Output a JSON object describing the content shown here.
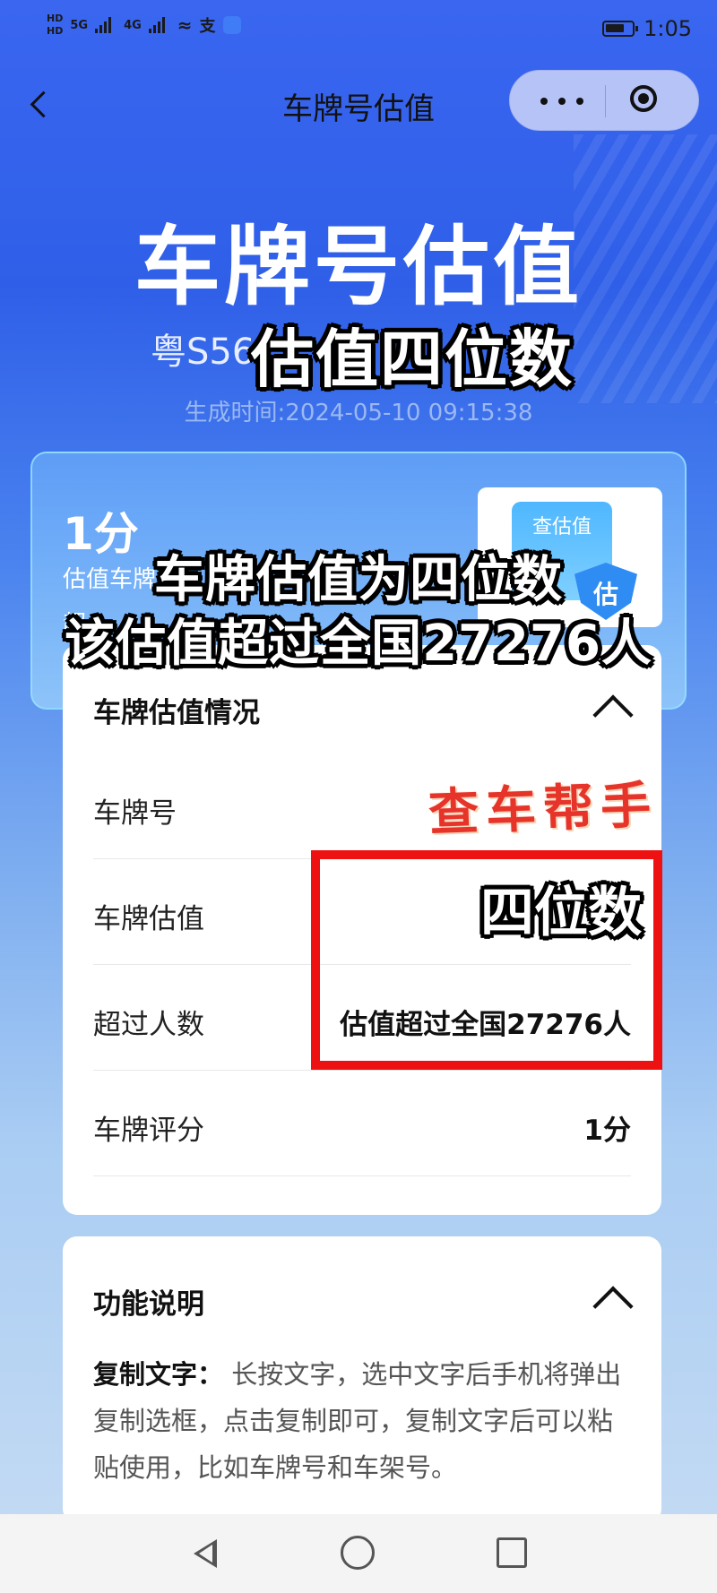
{
  "status_bar": {
    "hd1": "HD",
    "hd2": "HD",
    "net1": "5G",
    "net2": "4G",
    "time": "1:05"
  },
  "nav": {
    "title": "车牌号估值"
  },
  "hero": {
    "title": "车牌号估值",
    "plate_prefix": "粤S56",
    "generated_time": "生成时间:2024-05-10 09:15:38"
  },
  "score_card": {
    "score": "1分",
    "line1": "估值车牌",
    "line2": "超",
    "query_label": "查估值",
    "shield_text": "估"
  },
  "overlays": {
    "top": "估值四位数",
    "mid_line1": "车牌估值为四位数",
    "mid_line2": "该估值超过全国27276人",
    "box_text": "四位数",
    "watermark": "查车帮手"
  },
  "valuation_panel": {
    "title": "车牌估值情况",
    "rows": [
      {
        "label": "车牌号",
        "value": ""
      },
      {
        "label": "车牌估值",
        "value": ""
      },
      {
        "label": "超过人数",
        "value": "估值超过全国27276人"
      },
      {
        "label": "车牌评分",
        "value": "1分"
      }
    ]
  },
  "function_panel": {
    "title": "功能说明",
    "desc_bold": "复制文字：",
    "desc_text": " 长按文字，选中文字后手机将弹出复制选框，点击复制即可，复制文字后可以粘贴使用，比如车牌号和车架号。"
  }
}
